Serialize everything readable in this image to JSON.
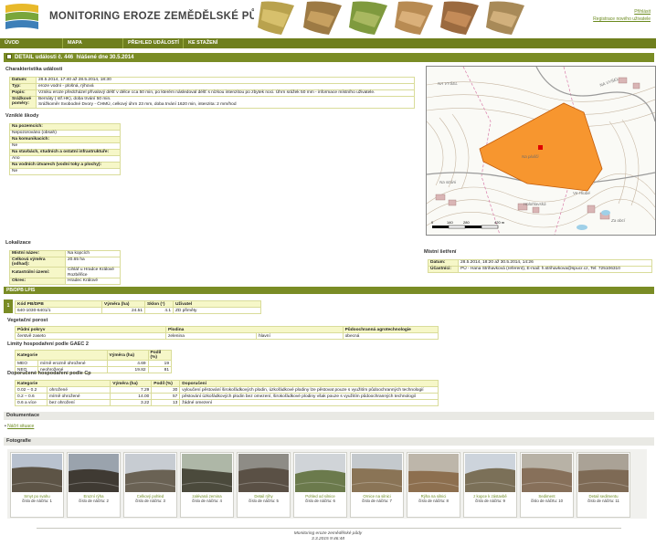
{
  "header": {
    "title": "MONITORING EROZE ZEMĚDĚLSKÉ PŮDY",
    "login": "Přihlásit",
    "register": "Registrace nového uživatele"
  },
  "nav": [
    "ÚVOD",
    "MAPA",
    "PŘEHLED UDÁLOSTÍ",
    "KE STAŽENÍ"
  ],
  "detail": {
    "bar_title": "DETAIL události č. 446",
    "reported": "hlášené dne 30.5.2014"
  },
  "characteristics": {
    "heading": "Charakteristika události",
    "rows": [
      {
        "k": "Datum:",
        "v": "28.5.2014, 17:40 až 28.5.2014, 18:30"
      },
      {
        "k": "Typ:",
        "v": "eroze vodní - plošná, rýhová"
      },
      {
        "k": "Popis:",
        "v": "Vzniku eroze předcházel přívalový déšť v délce cca 50 min, po kterém následoval déšť s nízkou intenzitou po zbytek noci. Úhrn srážek 50 mm - informace místního uživatele."
      },
      {
        "k": "Srážkové poměry:",
        "v": "Bernáty ( stř.HK), doba trvání 50 min.\nSrážkoměr Svobodné Dvory - ČHMÚ, celkový úhrn 23 mm, doba trvání 1620 min, intenzita: 2 mm/hod"
      }
    ]
  },
  "damage": {
    "heading": "Vzniklé škody",
    "items": [
      {
        "k": "Na pozemcích:",
        "v": "Nepozorováno (obsah)"
      },
      {
        "k": "Na komunikacích:",
        "v": "Ne"
      },
      {
        "k": "Na stavbách, studních a ostatní infrastruktuře:",
        "v": "Ano"
      },
      {
        "k": "Na vodních útvarech (vodní toky a plochy):",
        "v": "Ne"
      }
    ]
  },
  "map": {
    "labels": [
      "NA VYŠEL",
      "NA VYŠEL",
      "Holohlavská",
      "Na plušči",
      "Ve Hrubé",
      "Za obcí",
      "Na stráni"
    ],
    "scale": [
      "0",
      "140",
      "280",
      "420 m"
    ]
  },
  "localization": {
    "heading": "Lokalizace",
    "rows": [
      {
        "k": "Místní název:",
        "v": "Na kopcích"
      },
      {
        "k": "Celková výměra (odhad):",
        "v": "20.65 ha"
      },
      {
        "k": "Katastrální území:",
        "v": "Cihlář u Hradce Králové\nRozběřice"
      },
      {
        "k": "Okres:",
        "v": "Hradec Králové"
      }
    ]
  },
  "survey": {
    "heading": "Místní šetření",
    "rows": [
      {
        "k": "Datum:",
        "v": "28.5.2014, 18:20 až 30.5.2014, 14:26"
      },
      {
        "k": "Účastníci:",
        "v": "PÚ - Hana Strihavková (referent), E-mail: h.strihavkova@spucr.cz, Tel: 725106310"
      }
    ]
  },
  "lpis": {
    "bar": "PB/DPB LPIS",
    "index": "1",
    "headers": [
      "Kód PB/DPB",
      "Výměra (ha)",
      "Sklon (°)",
      "Uživatel"
    ],
    "row": [
      "640-1030-6401/1",
      "24.51",
      "4.1",
      "ZD přiměty"
    ]
  },
  "vegetation": {
    "heading": "Vegetační porost",
    "headers": [
      "Půdní pokryv",
      "Plodina",
      "Půdoochranná agrotechnologie"
    ],
    "row": [
      "čerstvě zaseto",
      "zelenina",
      "hlavní",
      "obecná"
    ]
  },
  "gaec": {
    "heading": "Limity hospodaření podle GAEC 2",
    "headers": [
      "Kategorie",
      "Výměra (ha)",
      "Podíl (%)"
    ],
    "rows": [
      [
        "MEO",
        "mírně erozně ohrožené",
        "4.69",
        "19"
      ],
      [
        "NEO",
        "neohrožené",
        "19.82",
        "81"
      ]
    ]
  },
  "cp": {
    "heading": "Doporučené hospodaření podle Cp",
    "headers": [
      "Kategorie",
      "Výměra (ha)",
      "Podíl (%)",
      "Doporučení"
    ],
    "rows": [
      [
        "0.02 – 0.2",
        "ohrožené",
        "7.29",
        "30",
        "vyloučení pěstování širokořádkových plodin, úzkořádkové plodiny lze pěstovat pouze s využitím půdoochranných technologií"
      ],
      [
        "0.2 – 0.6",
        "mírně ohrožené",
        "14.00",
        "57",
        "pěstování úzkořádkových plodin bez omezení, širokořádkové plodiny však pouze s využitím půdoochranných technologií"
      ],
      [
        "0.6 a více",
        "bez ohrožení",
        "3.22",
        "13",
        "žádné omezení"
      ]
    ]
  },
  "documentation": {
    "bar": "Dokumentace",
    "link": "Náčrt situace"
  },
  "photos": {
    "bar": "Fotografie",
    "items": [
      {
        "cap": "Smyt po svahu",
        "num": "číslo de náčrtu: 1",
        "sky": "#b9c2cf",
        "ground": "#5d5446"
      },
      {
        "cap": "Erozní rýha",
        "num": "číslo de náčrtu: 2",
        "sky": "#9aa3ad",
        "ground": "#3f3a33"
      },
      {
        "cap": "Celkový pohled",
        "num": "číslo de náčrtu: 3",
        "sky": "#c7ccd2",
        "ground": "#6a6254"
      },
      {
        "cap": "zalévaná zemina",
        "num": "číslo de náčrtu: 4",
        "sky": "#aeb7a7",
        "ground": "#4b4a3c"
      },
      {
        "cap": "Detail rýhy",
        "num": "číslo de náčrtu: 5",
        "sky": "#8e8c86",
        "ground": "#5a5045"
      },
      {
        "cap": "Pohled od silnice",
        "num": "číslo de náčrtu: 6",
        "sky": "#d0d4d8",
        "ground": "#6b7a4c"
      },
      {
        "cap": "Ornice na silnici",
        "num": "číslo de náčrtu: 7",
        "sky": "#c4c9cd",
        "ground": "#8a7456"
      },
      {
        "cap": "Rýha na silnici",
        "num": "číslo de náčrtu: 8",
        "sky": "#bdb6aa",
        "ground": "#8d6f4f"
      },
      {
        "cap": "z kopce k zástavbě",
        "num": "číslo de náčrtu: 9",
        "sky": "#cdd4dc",
        "ground": "#7b7058"
      },
      {
        "cap": "Sediment",
        "num": "číslo de náčrtu: 10",
        "sky": "#b8b2a6",
        "ground": "#87705a"
      },
      {
        "cap": "Detail sedimentu",
        "num": "číslo de náčrtu: 11",
        "sky": "#aaa296",
        "ground": "#7e6a55"
      }
    ]
  },
  "footer": {
    "line1": "Monitoring eroze zemědělské půdy",
    "line2": "3.3.2015 9:46:48"
  },
  "colors": {
    "nav": "#6f7f1e",
    "bar": "#7a8c25",
    "label_bg": "#f6f7c8",
    "link": "#6b8a1e",
    "erosion_area": "#f7962f"
  }
}
